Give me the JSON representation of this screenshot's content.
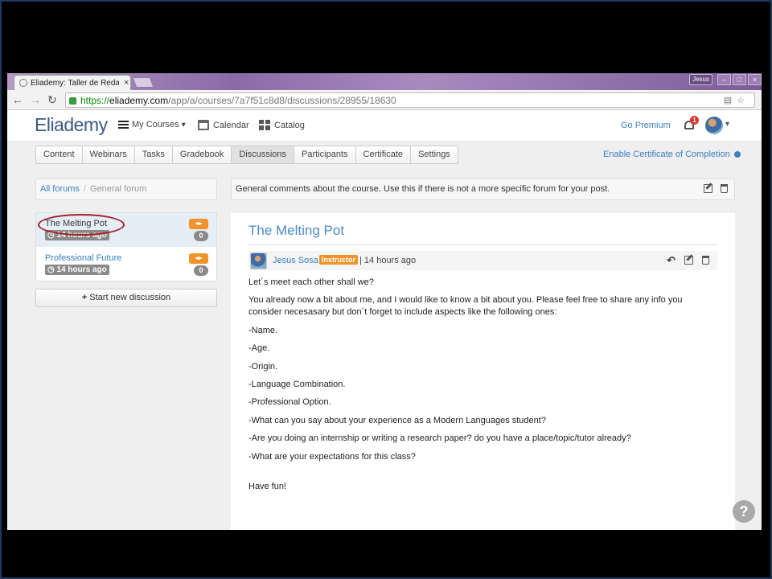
{
  "browser": {
    "tab_title": "Eliademy: Taller de Redacc",
    "tab_close": "×",
    "window_user": "Jesus",
    "window_buttons": [
      "–",
      "□",
      "×"
    ],
    "url_scheme": "https://",
    "url_host": "eliademy.com",
    "url_path": "/app/a/courses/7a7f51c8d8/discussions/28955/18630"
  },
  "header": {
    "logo": "Eliademy",
    "my_courses": "My Courses",
    "my_courses_chevron": "▾",
    "calendar": "Calendar",
    "catalog": "Catalog",
    "go_premium": "Go Premium",
    "notification_count": "1"
  },
  "course_tabs": [
    "Content",
    "Webinars",
    "Tasks",
    "Gradebook",
    "Discussions",
    "Participants",
    "Certificate",
    "Settings"
  ],
  "active_tab": "Discussions",
  "enable_certificate": "Enable Certificate of Completion",
  "breadcrumb": {
    "all_forums": "All forums",
    "separator": "/",
    "current": "General forum"
  },
  "forum_description": "General comments about the course. Use this if there is not a more specific forum for your post.",
  "threads": [
    {
      "title": "The Melting Pot",
      "time": "14 hours ago",
      "count": "0"
    },
    {
      "title": "Professional Future",
      "time": "14 hours ago",
      "count": "0"
    }
  ],
  "new_discussion": "Start new discussion",
  "post": {
    "title": "The Melting Pot",
    "author": "Jesus Sosa",
    "role_badge": "Instructor",
    "time": "| 14 hours ago",
    "body": [
      "Let´s meet each other shall we?",
      "You already now a bit about me, and I would like to know a bit about you. Please feel free to share any info you consider necesasary but don´t forget to include aspects like the following ones:",
      "-Name.",
      "-Age.",
      "-Origin.",
      "-Language Combination.",
      "-Professional Option.",
      "-What can you say about your experience as a Modern Languages student?",
      "-Are you doing an internship or writing a research paper? do you have a place/topic/tutor already?",
      "-What are your expectations for this class?",
      "Have fun!"
    ]
  },
  "help_label": "?",
  "colors": {
    "accent": "#3a7fc1",
    "badge_orange": "#f0932b",
    "annotation_red": "#a41e24"
  }
}
